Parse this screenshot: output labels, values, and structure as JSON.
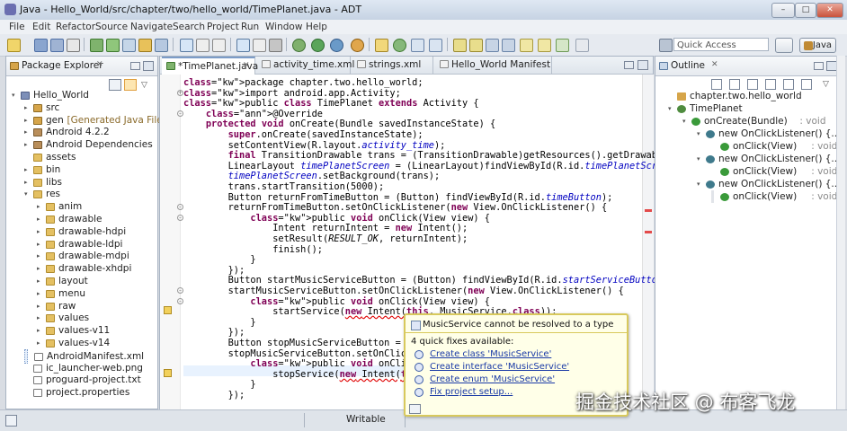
{
  "window": {
    "title": "Java - Hello_World/src/chapter/two/hello_world/TimePlanet.java - ADT"
  },
  "menu": [
    "File",
    "Edit",
    "Refactor",
    "Source",
    "Navigate",
    "Search",
    "Project",
    "Run",
    "Window",
    "Help"
  ],
  "toolbar": {
    "quick_access_placeholder": "Quick Access",
    "perspective_label": "Java"
  },
  "package_explorer": {
    "tab_label": "Package Explorer",
    "items": [
      {
        "label": "Hello_World",
        "type": "proj",
        "depth": 0,
        "toggle": "▾"
      },
      {
        "label": "src",
        "type": "pkg",
        "depth": 1,
        "toggle": "▸"
      },
      {
        "label": "gen",
        "suffix": "[Generated Java Files]",
        "type": "pkg",
        "depth": 1,
        "toggle": "▸"
      },
      {
        "label": "Android 4.2.2",
        "type": "jar",
        "depth": 1,
        "toggle": "▸"
      },
      {
        "label": "Android Dependencies",
        "type": "jar",
        "depth": 1,
        "toggle": "▸"
      },
      {
        "label": "assets",
        "type": "folder",
        "depth": 1,
        "toggle": ""
      },
      {
        "label": "bin",
        "type": "folder",
        "depth": 1,
        "toggle": "▸"
      },
      {
        "label": "libs",
        "type": "folder",
        "depth": 1,
        "toggle": "▸"
      },
      {
        "label": "res",
        "type": "folder",
        "depth": 1,
        "toggle": "▾"
      },
      {
        "label": "anim",
        "type": "folder",
        "depth": 2,
        "toggle": "▸"
      },
      {
        "label": "drawable",
        "type": "folder",
        "depth": 2,
        "toggle": "▸"
      },
      {
        "label": "drawable-hdpi",
        "type": "folder",
        "depth": 2,
        "toggle": "▸"
      },
      {
        "label": "drawable-ldpi",
        "type": "folder",
        "depth": 2,
        "toggle": "▸"
      },
      {
        "label": "drawable-mdpi",
        "type": "folder",
        "depth": 2,
        "toggle": "▸"
      },
      {
        "label": "drawable-xhdpi",
        "type": "folder",
        "depth": 2,
        "toggle": "▸"
      },
      {
        "label": "layout",
        "type": "folder",
        "depth": 2,
        "toggle": "▸"
      },
      {
        "label": "menu",
        "type": "folder",
        "depth": 2,
        "toggle": "▸"
      },
      {
        "label": "raw",
        "type": "folder",
        "depth": 2,
        "toggle": "▸"
      },
      {
        "label": "values",
        "type": "folder",
        "depth": 2,
        "toggle": "▸"
      },
      {
        "label": "values-v11",
        "type": "folder",
        "depth": 2,
        "toggle": "▸"
      },
      {
        "label": "values-v14",
        "type": "folder",
        "depth": 2,
        "toggle": "▸"
      },
      {
        "label": "AndroidManifest.xml",
        "type": "file",
        "depth": 1,
        "toggle": "",
        "selected": true
      },
      {
        "label": "ic_launcher-web.png",
        "type": "file",
        "depth": 1,
        "toggle": ""
      },
      {
        "label": "proguard-project.txt",
        "type": "file",
        "depth": 1,
        "toggle": ""
      },
      {
        "label": "project.properties",
        "type": "file",
        "depth": 1,
        "toggle": ""
      }
    ]
  },
  "editor": {
    "tabs": [
      {
        "label": "*TimePlanet.java",
        "active": true
      },
      {
        "label": "activity_time.xml",
        "active": false
      },
      {
        "label": "strings.xml",
        "active": false
      },
      {
        "label": "Hello_World Manifest",
        "active": false
      }
    ],
    "lines": [
      "package chapter.two.hello_world;",
      "import android.app.Activity;",
      "public class TimePlanet extends Activity {",
      "    @Override",
      "    protected void onCreate(Bundle savedInstanceState) {",
      "        super.onCreate(savedInstanceState);",
      "        setContentView(R.layout.activity_time);",
      "        final TransitionDrawable trans = (TransitionDrawable)getResources().getDrawable(R.dr",
      "        LinearLayout timePlanetScreen = (LinearLayout)findViewById(R.id.timePlanetScreen);",
      "        timePlanetScreen.setBackground(trans);",
      "        trans.startTransition(5000);",
      "        Button returnFromTimeButton = (Button) findViewById(R.id.timeButton);",
      "        returnFromTimeButton.setOnClickListener(new View.OnClickListener() {",
      "            public void onClick(View view) {",
      "                Intent returnIntent = new Intent();",
      "                setResult(RESULT_OK, returnIntent);",
      "                finish();",
      "            }",
      "        });",
      "        Button startMusicServiceButton = (Button) findViewById(R.id.startServiceButton);",
      "        startMusicServiceButton.setOnClickListener(new View.OnClickListener() {",
      "            public void onClick(View view) {",
      "                startService(new Intent(this, MusicService.class));",
      "            }",
      "        });",
      "        Button stopMusicServiceButton = (Butt",
      "        stopMusicServiceButton.setOnClickList",
      "            public void onClick(View view) {",
      "                stopService(new Intent(this,",
      "            }",
      "        });"
    ]
  },
  "outline": {
    "tab_label": "Outline",
    "items": [
      {
        "label": "chapter.two.hello_world",
        "detail": "",
        "depth": 0,
        "kind": "package"
      },
      {
        "label": "TimePlanet",
        "detail": "",
        "depth": 0,
        "kind": "class"
      },
      {
        "label": "onCreate(Bundle)",
        "detail": ": void",
        "depth": 1,
        "kind": "method"
      },
      {
        "label": "new OnClickListener() {...}",
        "detail": "",
        "depth": 2,
        "kind": "anon"
      },
      {
        "label": "onClick(View)",
        "detail": ": void",
        "depth": 3,
        "kind": "method"
      },
      {
        "label": "new OnClickListener() {...}",
        "detail": "",
        "depth": 2,
        "kind": "anon"
      },
      {
        "label": "onClick(View)",
        "detail": ": void",
        "depth": 3,
        "kind": "method"
      },
      {
        "label": "new OnClickListener() {...}",
        "detail": "",
        "depth": 2,
        "kind": "anon"
      },
      {
        "label": "onClick(View)",
        "detail": ": void",
        "depth": 3,
        "kind": "method",
        "selected": true
      }
    ]
  },
  "quickfix": {
    "header": "MusicService cannot be resolved to a type",
    "subheader": "4 quick fixes available:",
    "fixes": [
      "Create class 'MusicService'",
      "Create interface 'MusicService'",
      "Create enum 'MusicService'",
      "Fix project setup..."
    ]
  },
  "status": {
    "mode": "Writable"
  },
  "watermark": "掘金技术社区 @ 布客飞龙"
}
